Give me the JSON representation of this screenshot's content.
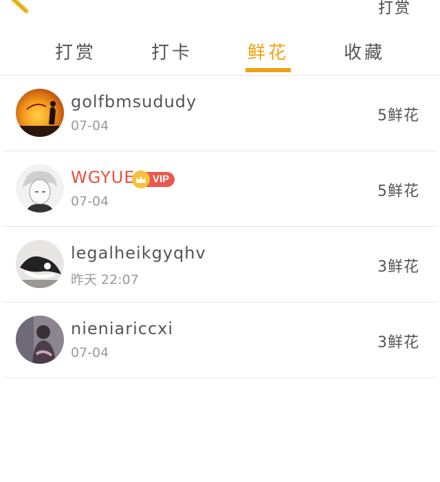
{
  "header": {
    "action_label": "打赏"
  },
  "tabs": [
    {
      "label": "打赏",
      "active": false
    },
    {
      "label": "打卡",
      "active": false
    },
    {
      "label": "鲜花",
      "active": true
    },
    {
      "label": "收藏",
      "active": false
    }
  ],
  "colors": {
    "accent": "#f0a010",
    "vip_name": "#e8503a",
    "vip_badge": "#e95a4e",
    "divider": "#e8e8e8"
  },
  "records": [
    {
      "name": "golfbmsududy",
      "date": "07-04",
      "amount": "5鲜花",
      "vip": false
    },
    {
      "name": "WGYUE",
      "date": "07-04",
      "amount": "5鲜花",
      "vip": true,
      "vip_label": "VIP"
    },
    {
      "name": "legalheikgyqhv",
      "date": "昨天 22:07",
      "amount": "3鲜花",
      "vip": false
    },
    {
      "name": "nieniariccxi",
      "date": "07-04",
      "amount": "3鲜花",
      "vip": false
    }
  ]
}
